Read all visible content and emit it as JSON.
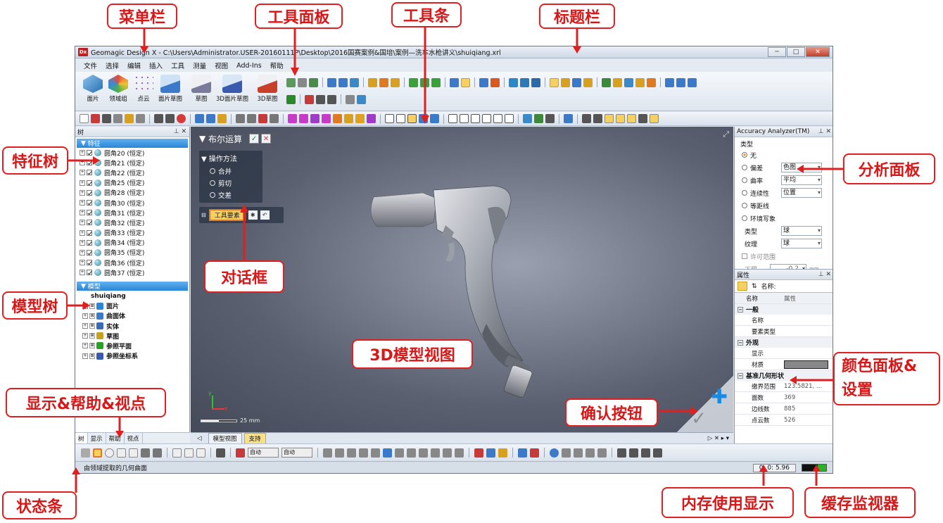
{
  "app": {
    "title": "Geomagic Design X - C:\\Users\\Administrator.USER-20160111P\\Desktop\\2016国赛案例&国培\\案例—洗车水枪讲义\\shuiqiang.xrl",
    "logo": "Dx",
    "win_buttons": [
      "─",
      "□",
      "✕"
    ]
  },
  "menu": [
    "文件",
    "选择",
    "编辑",
    "插入",
    "工具",
    "测量",
    "视图",
    "Add-Ins",
    "帮助"
  ],
  "ribbon": {
    "big_buttons": [
      {
        "label": "面片",
        "color": "#5aa0d8"
      },
      {
        "label": "领域组",
        "color": "#d85a5a"
      },
      {
        "label": "点云",
        "color": "#a06ad0"
      },
      {
        "label": "面片草图",
        "color": "#4a8ac8"
      },
      {
        "label": "草图",
        "color": "#7a7a9a"
      },
      {
        "label": "3D面片草图",
        "color": "#4a6ab8"
      },
      {
        "label": "3D草图",
        "color": "#c8402a"
      }
    ]
  },
  "left_panel": {
    "header": "树",
    "controls": "⊥ ✕",
    "feature_section": "特征",
    "features": [
      "圆角20 (恒定)",
      "圆角21 (恒定)",
      "圆角22 (恒定)",
      "圆角25 (恒定)",
      "圆角28 (恒定)",
      "圆角30 (恒定)",
      "圆角31 (恒定)",
      "圆角32 (恒定)",
      "圆角33 (恒定)",
      "圆角34 (恒定)",
      "圆角35 (恒定)",
      "圆角36 (恒定)",
      "圆角37 (恒定)"
    ],
    "model_section": "模型",
    "model_root": "shuiqiang",
    "model_items": [
      "面片",
      "曲面体",
      "实体",
      "草图",
      "参照平面",
      "参照坐标系"
    ],
    "bottom_tabs": [
      "树",
      "显示",
      "帮助",
      "视点"
    ]
  },
  "dialog": {
    "title": "布尔运算",
    "section": "操作方法",
    "options": [
      "合并",
      "剪切",
      "交差"
    ],
    "selected": 0,
    "tool_field": "工具要素"
  },
  "viewport": {
    "scale_label": "25 mm",
    "tabs": [
      "模型视图",
      "支持"
    ]
  },
  "analyzer": {
    "header": "Accuracy Analyzer(TM)",
    "type_label": "类型",
    "options": [
      "无",
      "偏差",
      "曲率",
      "连续性",
      "等距线",
      "环境写象"
    ],
    "selected": 0,
    "deviation_value": "色图",
    "curvature_value": "平均",
    "continuity_value": "位置",
    "shape_label": "类型",
    "shape_value": "球",
    "texture_label": "纹理",
    "texture_value": "球",
    "range_label": "许可范围",
    "lower_label": "下限",
    "lower_value": "-0.2",
    "lower_unit": "mm"
  },
  "properties": {
    "header": "属性",
    "name_label": "名称:",
    "col_name": "名称",
    "col_attr": "属性",
    "groups": [
      {
        "title": "一般",
        "rows": [
          {
            "k": "名称",
            "v": ""
          },
          {
            "k": "要素类型",
            "v": ""
          }
        ]
      },
      {
        "title": "外观",
        "rows": [
          {
            "k": "显示",
            "v": ""
          },
          {
            "k": "材质",
            "v": ""
          }
        ]
      },
      {
        "title": "基准几何形状",
        "rows": [
          {
            "k": "缴界范围",
            "v": "123.5821, ..."
          },
          {
            "k": "面数",
            "v": "369"
          },
          {
            "k": "边线数",
            "v": "885"
          },
          {
            "k": "点云数",
            "v": "526"
          }
        ]
      }
    ]
  },
  "status": {
    "text": "由领域提取的几何曲面",
    "timer": "0: 0: 5.96",
    "toolbar_dropdown1": "自动",
    "toolbar_dropdown2": "自动"
  },
  "annotations": {
    "menu_bar": "菜单栏",
    "tool_panel": "工具面板",
    "tool_bar": "工具条",
    "title_bar": "标题栏",
    "feature_tree": "特征树",
    "analysis_panel": "分析面板",
    "dialog_box": "对话框",
    "model_tree": "模型树",
    "model_view": "3D模型视图",
    "color_panel": "颜色面板&\n设置",
    "display_help": "显示&帮助&视点",
    "confirm_button": "确认按钮",
    "status_bar": "状态条",
    "memory_display": "内存使用显示",
    "cache_monitor": "缓存监视器"
  },
  "colors": {
    "annotation_red": "#e02020",
    "section_blue": "#2a86d6",
    "active_tab": "#f6e08a"
  }
}
